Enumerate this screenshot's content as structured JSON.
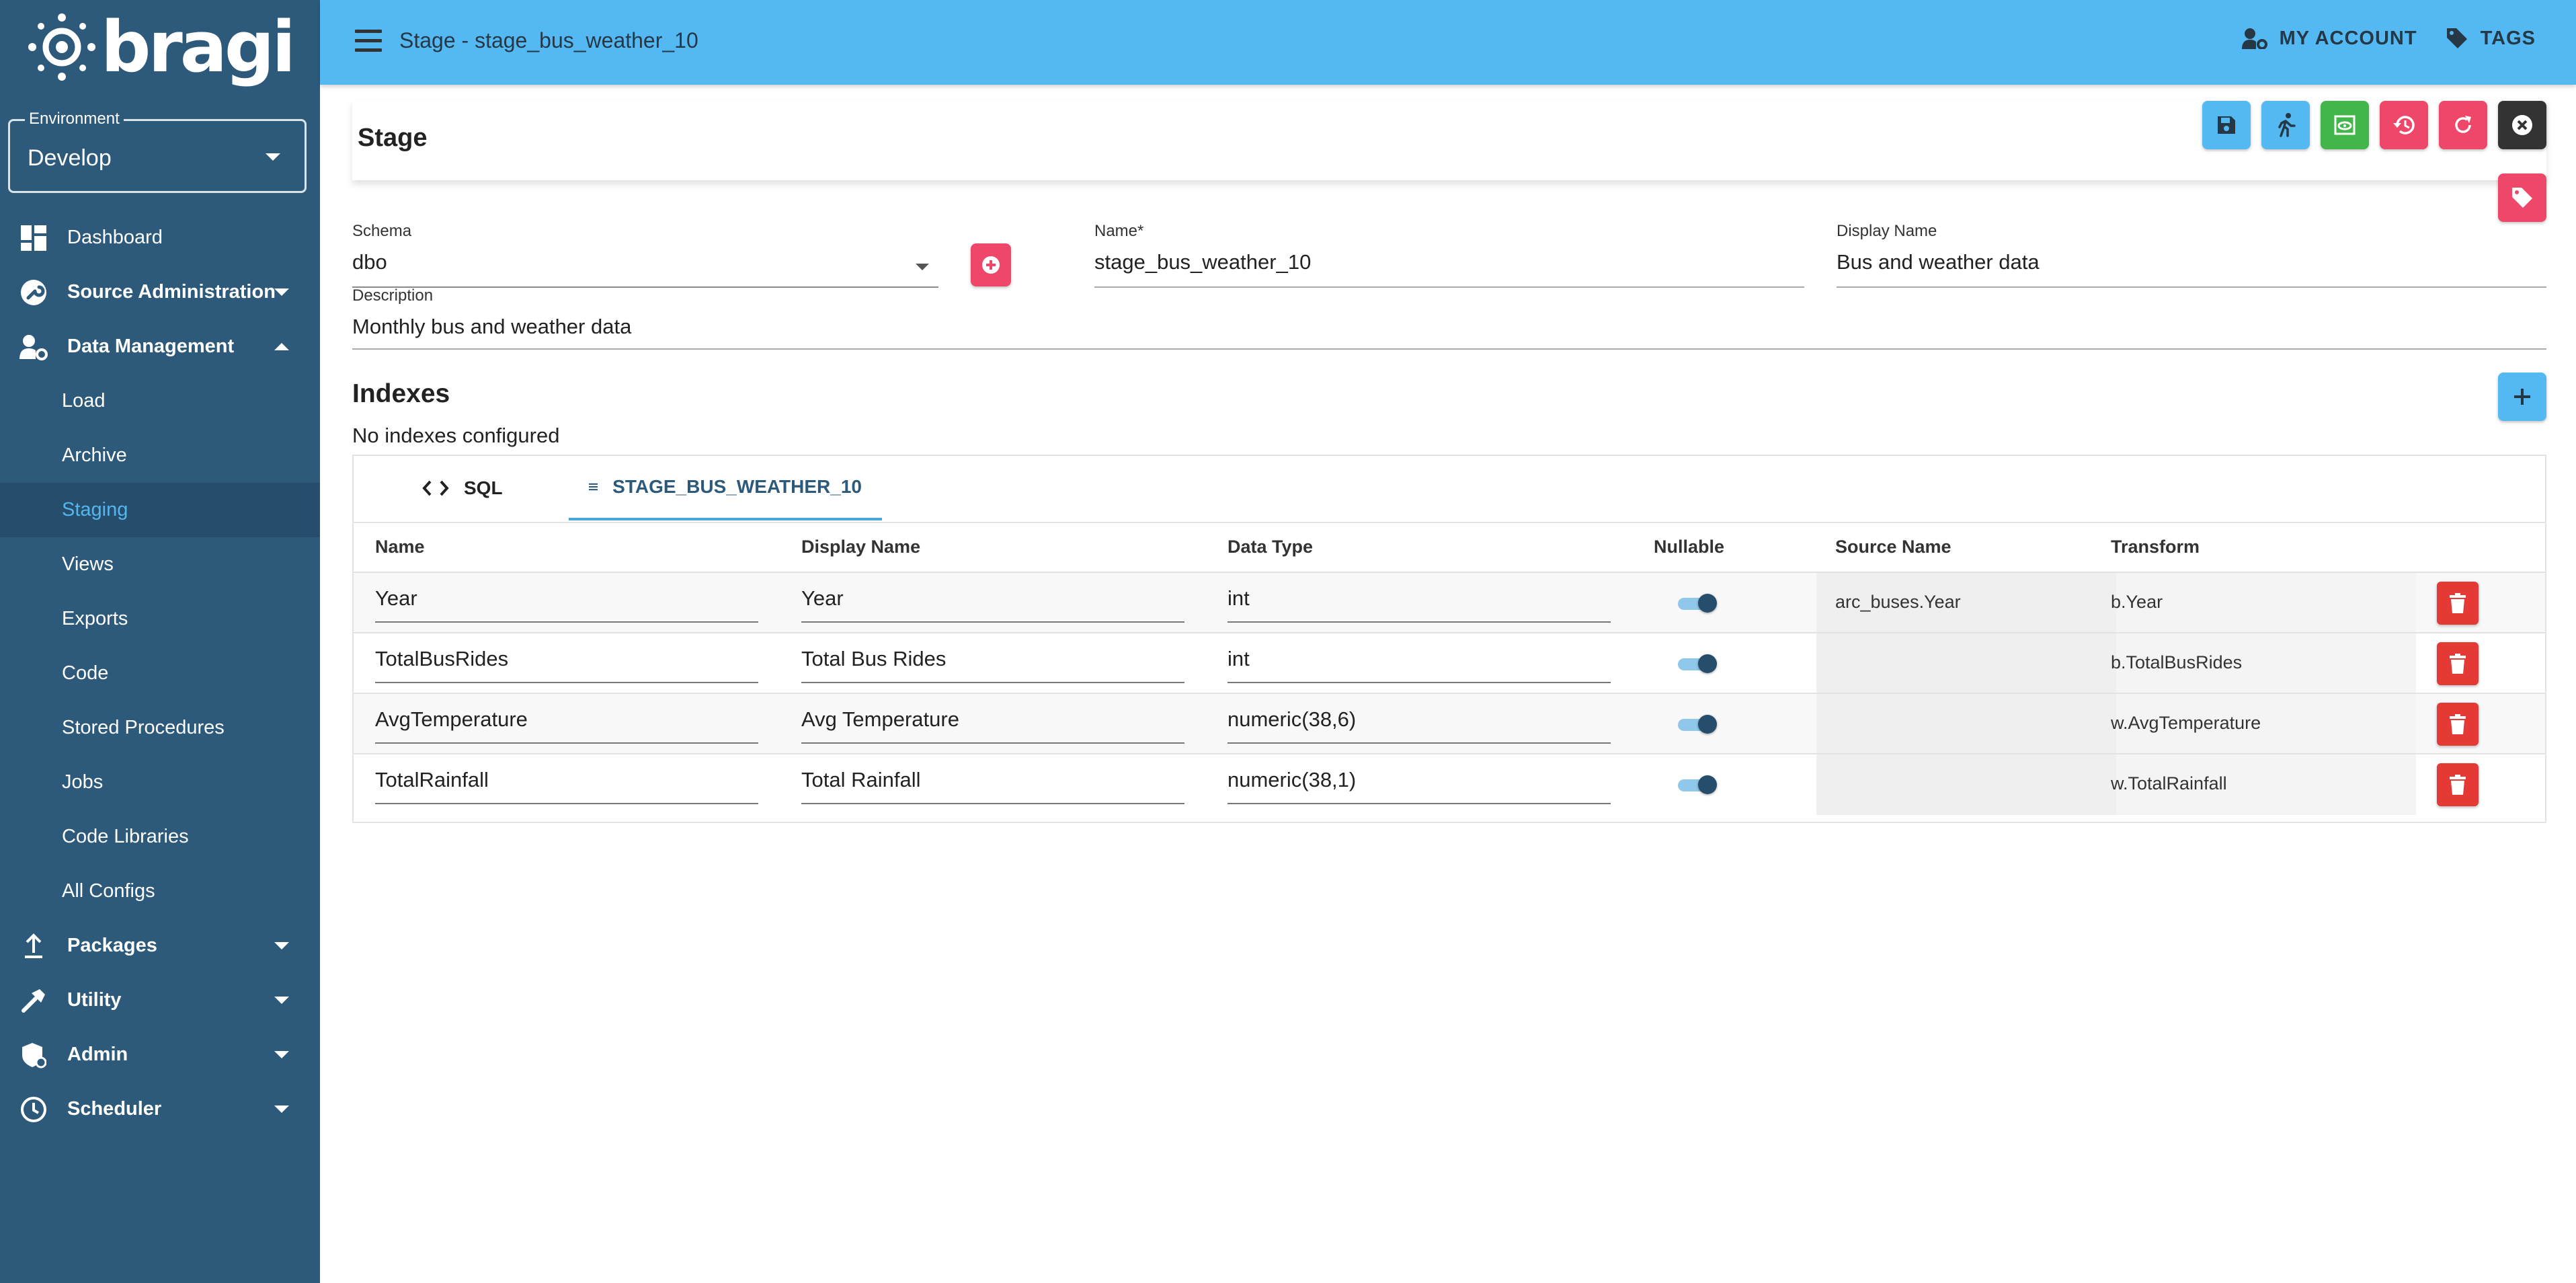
{
  "app": {
    "logo_text": "bragi",
    "window_title": "Stage - stage_bus_weather_10"
  },
  "environment": {
    "label": "Environment",
    "value": "Develop"
  },
  "sidebar": {
    "items": [
      {
        "label": "Dashboard",
        "icon": "dashboard-icon"
      },
      {
        "label": "Source Administration",
        "icon": "wrench-icon"
      },
      {
        "label": "Data Management",
        "icon": "user-gear-icon"
      },
      {
        "label": "Load"
      },
      {
        "label": "Archive"
      },
      {
        "label": "Staging"
      },
      {
        "label": "Views"
      },
      {
        "label": "Exports"
      },
      {
        "label": "Code"
      },
      {
        "label": "Stored Procedures"
      },
      {
        "label": "Jobs"
      },
      {
        "label": "Code Libraries"
      },
      {
        "label": "All Configs"
      },
      {
        "label": "Packages",
        "icon": "upload-icon"
      },
      {
        "label": "Utility",
        "icon": "hammer-icon"
      },
      {
        "label": "Admin",
        "icon": "shield-icon"
      },
      {
        "label": "Scheduler",
        "icon": "clock-icon"
      }
    ],
    "active": "Staging"
  },
  "topbar": {
    "account_label": "MY ACCOUNT",
    "tags_label": "TAGS"
  },
  "stage": {
    "title": "Stage",
    "actions": [
      {
        "name": "save",
        "icon": "save-icon",
        "color": "#54b9f3"
      },
      {
        "name": "run",
        "icon": "run-icon",
        "color": "#54b9f3"
      },
      {
        "name": "preview",
        "icon": "preview-icon",
        "color": "#43b649"
      },
      {
        "name": "history",
        "icon": "history-icon",
        "color": "#ef4769"
      },
      {
        "name": "refresh",
        "icon": "refresh-icon",
        "color": "#ef4769"
      },
      {
        "name": "close",
        "icon": "close-icon",
        "color": "#333333"
      },
      {
        "name": "tag",
        "icon": "tag-icon",
        "color": "#ef4769"
      }
    ]
  },
  "form": {
    "schema_label": "Schema",
    "schema_value": "dbo",
    "name_label": "Name*",
    "name_value": "stage_bus_weather_10",
    "display_name_label": "Display Name",
    "display_name_value": "Bus and weather data",
    "description_label": "Description",
    "description_value": "Monthly bus and weather data"
  },
  "indexes": {
    "title": "Indexes",
    "empty_text": "No indexes configured"
  },
  "tabs": [
    {
      "label": "SQL",
      "icon": "code-icon"
    },
    {
      "label": "STAGE_BUS_WEATHER_10",
      "icon": "list-icon",
      "active": true
    }
  ],
  "grid": {
    "columns": [
      "Name",
      "Display Name",
      "Data Type",
      "Nullable",
      "Source Name",
      "Transform"
    ],
    "rows": [
      {
        "name": "Year",
        "display": "Year",
        "type": "int",
        "nullable": true,
        "source": "arc_buses.Year",
        "transform": "b.Year"
      },
      {
        "name": "TotalBusRides",
        "display": "Total Bus Rides",
        "type": "int",
        "nullable": true,
        "source": "",
        "transform": "b.TotalBusRides"
      },
      {
        "name": "AvgTemperature",
        "display": "Avg Temperature",
        "type": "numeric(38,6)",
        "nullable": true,
        "source": "",
        "transform": "w.AvgTemperature"
      },
      {
        "name": "TotalRainfall",
        "display": "Total Rainfall",
        "type": "numeric(38,1)",
        "nullable": true,
        "source": "",
        "transform": "w.TotalRainfall"
      }
    ]
  }
}
